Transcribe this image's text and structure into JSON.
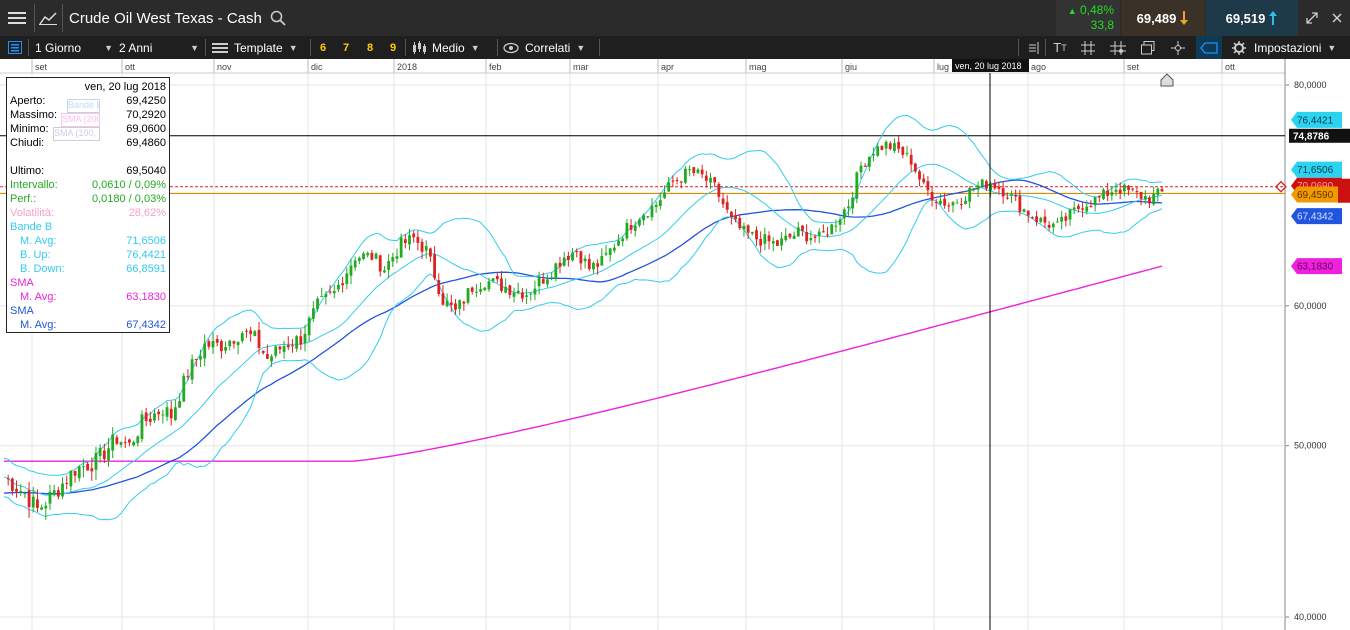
{
  "header": {
    "title": "Crude Oil West Texas - Cash",
    "change_pct": "0,48%",
    "change_pts": "33,8",
    "sell_price": "69,489",
    "buy_price": "69,519"
  },
  "toolbar": {
    "interval": "1 Giorno",
    "range": "2 Anni",
    "template": "Template",
    "presets": [
      "6",
      "7",
      "8",
      "9"
    ],
    "style": "Medio",
    "correlated": "Correlati",
    "settings": "Impostazioni"
  },
  "x_axis": {
    "months": [
      "set",
      "ott",
      "nov",
      "dic",
      "2018",
      "feb",
      "mar",
      "apr",
      "mag",
      "giu",
      "lug",
      "ago",
      "set",
      "ott"
    ],
    "crosshair_label": "ven, 20 lug 2018"
  },
  "y_axis": {
    "ticks": [
      "80,0000",
      "60,0000",
      "50,0000",
      "40,0000"
    ]
  },
  "price_tags": {
    "boll_up": "76,4421",
    "crosshair": "74,8786",
    "boll_avg": "71,6506",
    "last_sell": "70,0690",
    "last_buy": "69,4590",
    "sma_blue": "67,4342",
    "sma_magenta": "63,1830"
  },
  "legend_ghost": {
    "boll": "Bande B (20, 0, 2, 2)",
    "sma200": "SMA (200, 0)",
    "sma100": "SMA (100, 0)"
  },
  "infobox": {
    "date": "ven, 20 lug 2018",
    "open_label": "Aperto:",
    "open": "69,4250",
    "high_label": "Massimo:",
    "high": "70,2920",
    "low_label": "Minimo:",
    "low": "69,0600",
    "close_label": "Chiudi:",
    "close": "69,4860",
    "last_label": "Ultimo:",
    "last": "69,5040",
    "interval_label": "Intervallo:",
    "interval": "0,0610 / 0,09%",
    "perf_label": "Perf.:",
    "perf": "0,0180 / 0,03%",
    "vol_label": "Volatilità:",
    "vol": "28,62%",
    "boll_label": "Bande B",
    "boll_avg_label": "M. Avg:",
    "boll_avg": "71,6506",
    "boll_up_label": "B. Up:",
    "boll_up": "76,4421",
    "boll_down_label": "B. Down:",
    "boll_down": "66,8591",
    "sma1_label": "SMA",
    "sma1_avg_label": "M. Avg:",
    "sma1_avg": "63,1830",
    "sma2_label": "SMA",
    "sma2_avg_label": "M. Avg:",
    "sma2_avg": "67,4342"
  },
  "colors": {
    "up": "#22aa22",
    "down": "#dd2222",
    "bollinger": "#33ccee",
    "sma_blue": "#2255dd",
    "sma_magenta": "#ee22dd",
    "positive": "#22bb22",
    "sell_arrow": "#f0a030",
    "buy_arrow": "#33bbee",
    "accent": "#1e90ff"
  },
  "chart_data": {
    "type": "candlestick",
    "instrument": "Crude Oil West Texas - Cash",
    "interval": "1 Giorno",
    "ylim": [
      40,
      80
    ],
    "yticks": [
      80,
      60,
      50,
      40
    ],
    "xlabels": [
      "set",
      "ott",
      "nov",
      "dic",
      "2018",
      "feb",
      "mar",
      "apr",
      "mag",
      "giu",
      "lug",
      "ago",
      "set",
      "ott"
    ],
    "close_path": [
      [
        0,
        48.0
      ],
      [
        5,
        47.0
      ],
      [
        8,
        46.0
      ],
      [
        12,
        47.0
      ],
      [
        17,
        48.5
      ],
      [
        22,
        49.0
      ],
      [
        27,
        50.5
      ],
      [
        30,
        50.0
      ],
      [
        33,
        51.5
      ],
      [
        38,
        52.5
      ],
      [
        40,
        52.0
      ],
      [
        44,
        55.0
      ],
      [
        48,
        57.0
      ],
      [
        52,
        57.0
      ],
      [
        57,
        58.0
      ],
      [
        60,
        57.5
      ],
      [
        63,
        56.0
      ],
      [
        67,
        57.0
      ],
      [
        71,
        57.5
      ],
      [
        75,
        60.0
      ],
      [
        79,
        61.0
      ],
      [
        84,
        64.0
      ],
      [
        88,
        64.0
      ],
      [
        91,
        63.0
      ],
      [
        95,
        65.0
      ],
      [
        98,
        65.5
      ],
      [
        101,
        64.5
      ],
      [
        105,
        60.5
      ],
      [
        108,
        59.5
      ],
      [
        112,
        61.5
      ],
      [
        115,
        62.0
      ],
      [
        120,
        61.5
      ],
      [
        125,
        61.0
      ],
      [
        130,
        62.5
      ],
      [
        134,
        64.0
      ],
      [
        137,
        64.5
      ],
      [
        140,
        63.0
      ],
      [
        143,
        63.5
      ],
      [
        148,
        66.0
      ],
      [
        152,
        67.5
      ],
      [
        156,
        68.5
      ],
      [
        160,
        70.5
      ],
      [
        164,
        71.5
      ],
      [
        167,
        71.0
      ],
      [
        170,
        70.0
      ],
      [
        174,
        67.0
      ],
      [
        177,
        66.0
      ],
      [
        180,
        65.5
      ],
      [
        185,
        65.0
      ],
      [
        190,
        66.0
      ],
      [
        195,
        65.5
      ],
      [
        198,
        66.5
      ],
      [
        202,
        68.5
      ],
      [
        205,
        72.0
      ],
      [
        208,
        73.5
      ],
      [
        211,
        74.0
      ],
      [
        214,
        73.5
      ],
      [
        217,
        72.5
      ],
      [
        220,
        70.0
      ],
      [
        223,
        69.0
      ],
      [
        226,
        68.5
      ],
      [
        229,
        69.0
      ],
      [
        232,
        70.0
      ],
      [
        236,
        70.5
      ],
      [
        240,
        69.5
      ],
      [
        244,
        68.0
      ],
      [
        248,
        67.0
      ],
      [
        252,
        66.5
      ],
      [
        255,
        67.5
      ],
      [
        258,
        68.5
      ],
      [
        262,
        69.0
      ],
      [
        266,
        70.0
      ],
      [
        270,
        69.5
      ],
      [
        274,
        69.0
      ],
      [
        277,
        69.5
      ]
    ],
    "bollinger": {
      "upper": 76.4421,
      "mid": 71.6506,
      "lower": 66.8591
    },
    "sma_blue": {
      "start": 47.0,
      "end": 67.4342
    },
    "sma_magenta": {
      "start": 49.0,
      "end": 63.183
    },
    "crosshair": {
      "date": "ven, 20 lug 2018",
      "price": 74.8786
    },
    "bid": 69.489,
    "ask": 69.519
  }
}
